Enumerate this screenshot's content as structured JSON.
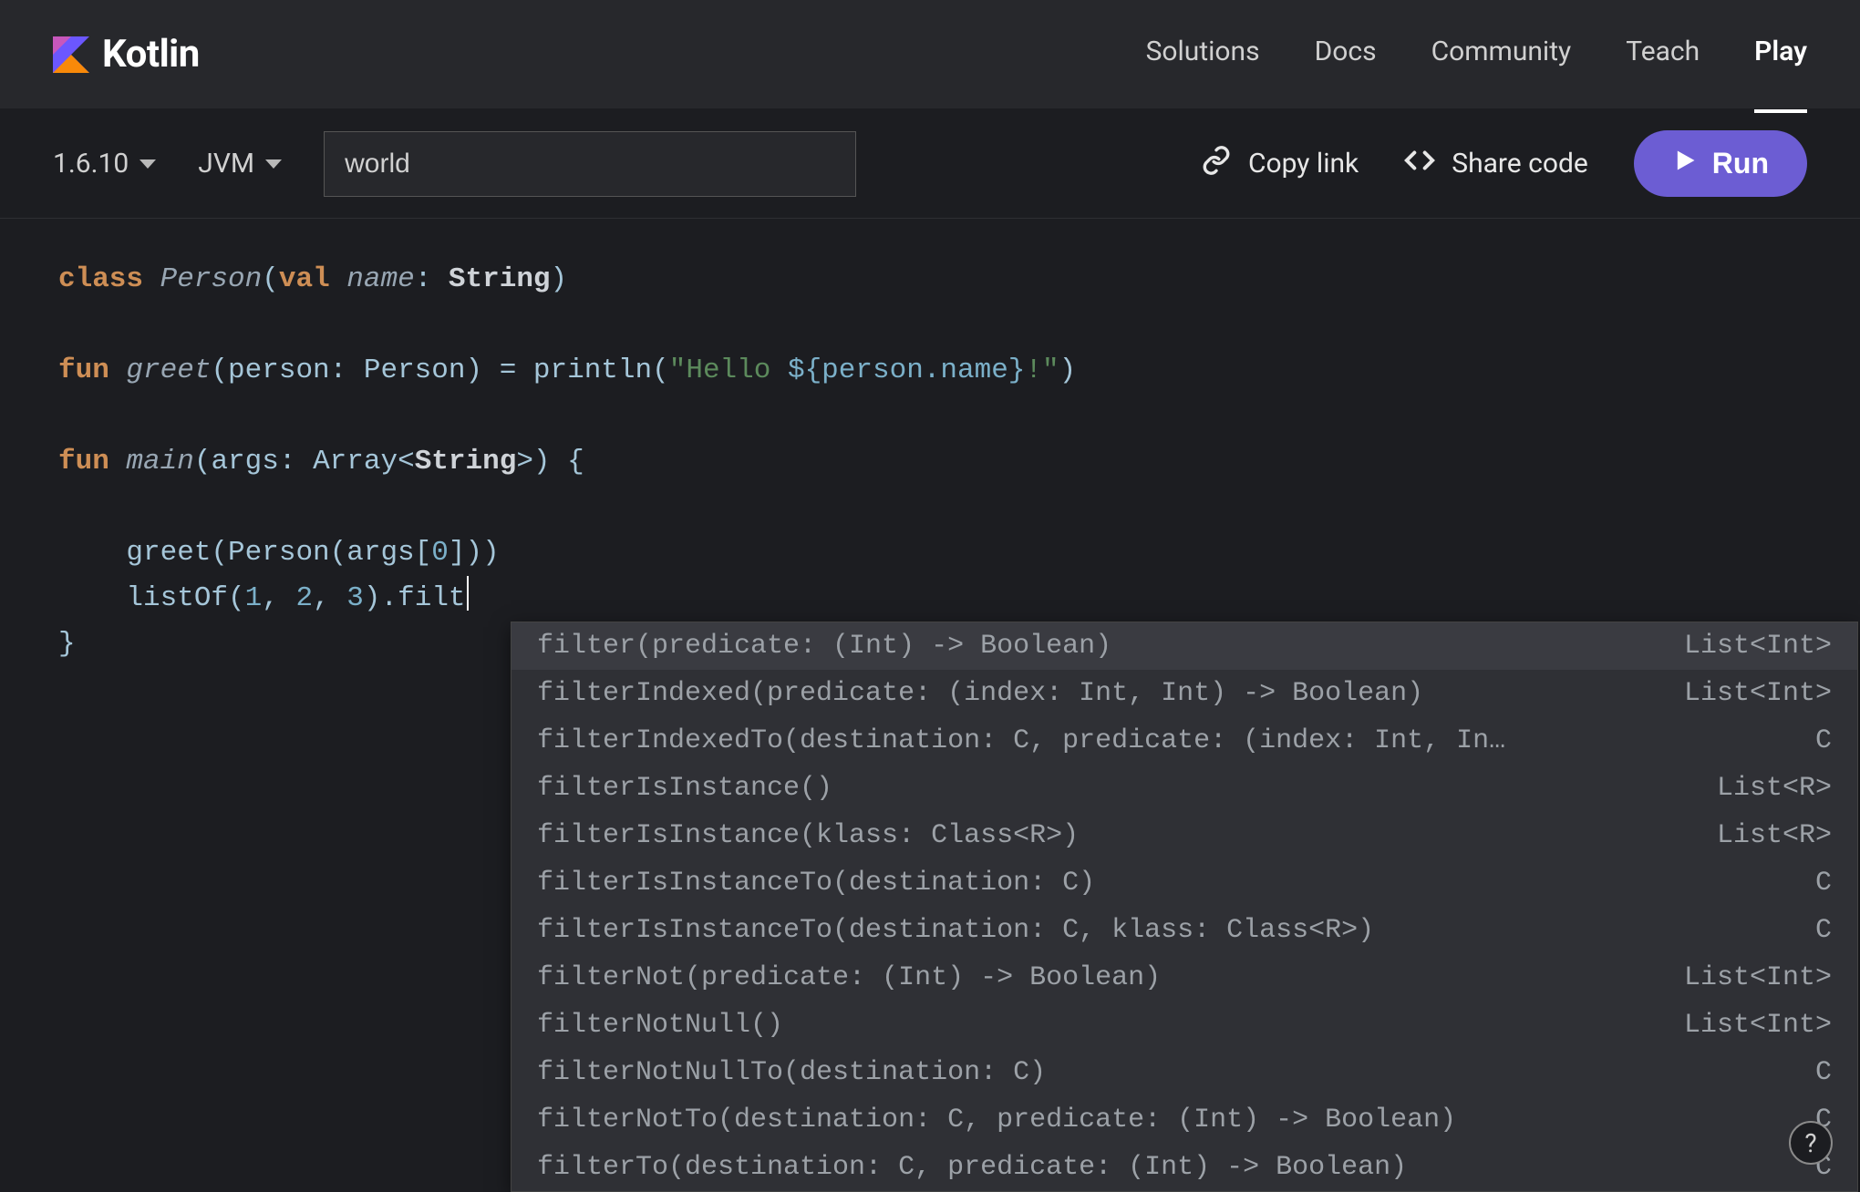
{
  "brand": {
    "name": "Kotlin"
  },
  "nav": {
    "items": [
      {
        "label": "Solutions",
        "active": false
      },
      {
        "label": "Docs",
        "active": false
      },
      {
        "label": "Community",
        "active": false
      },
      {
        "label": "Teach",
        "active": false
      },
      {
        "label": "Play",
        "active": true
      }
    ]
  },
  "toolbar": {
    "version": "1.6.10",
    "target": "JVM",
    "args_value": "world",
    "copy_link": "Copy link",
    "share_code": "Share code",
    "run": "Run"
  },
  "code": {
    "lines": [
      {
        "segments": [
          {
            "cls": "kw",
            "t": "class "
          },
          {
            "cls": "ident",
            "t": "Person"
          },
          {
            "cls": "plain",
            "t": "("
          },
          {
            "cls": "kw2",
            "t": "val "
          },
          {
            "cls": "ident",
            "t": "name"
          },
          {
            "cls": "plain",
            "t": ": "
          },
          {
            "cls": "type",
            "t": "String"
          },
          {
            "cls": "plain",
            "t": ")"
          }
        ]
      },
      {
        "segments": []
      },
      {
        "segments": [
          {
            "cls": "kw",
            "t": "fun "
          },
          {
            "cls": "ident",
            "t": "greet"
          },
          {
            "cls": "plain",
            "t": "(person: Person) = println("
          },
          {
            "cls": "str",
            "t": "\"Hello "
          },
          {
            "cls": "strvar",
            "t": "${person.name}"
          },
          {
            "cls": "str",
            "t": "!\""
          },
          {
            "cls": "plain",
            "t": ")"
          }
        ]
      },
      {
        "segments": []
      },
      {
        "segments": [
          {
            "cls": "kw",
            "t": "fun "
          },
          {
            "cls": "ident",
            "t": "main"
          },
          {
            "cls": "plain",
            "t": "(args: Array<"
          },
          {
            "cls": "type",
            "t": "String"
          },
          {
            "cls": "plain",
            "t": ">) {"
          }
        ]
      },
      {
        "segments": []
      },
      {
        "segments": [
          {
            "cls": "plain",
            "t": "    greet(Person(args["
          },
          {
            "cls": "num",
            "t": "0"
          },
          {
            "cls": "plain",
            "t": "]))"
          }
        ]
      },
      {
        "segments": [
          {
            "cls": "plain",
            "t": "    listOf("
          },
          {
            "cls": "num",
            "t": "1"
          },
          {
            "cls": "plain",
            "t": ", "
          },
          {
            "cls": "num",
            "t": "2"
          },
          {
            "cls": "plain",
            "t": ", "
          },
          {
            "cls": "num",
            "t": "3"
          },
          {
            "cls": "plain",
            "t": ").filt"
          }
        ],
        "cursor": true
      },
      {
        "segments": [
          {
            "cls": "plain",
            "t": "}"
          }
        ]
      }
    ]
  },
  "autocomplete": {
    "items": [
      {
        "sig": "filter(predicate: (Int) -> Boolean)",
        "ret": "List<Int>",
        "selected": true
      },
      {
        "sig": "filterIndexed(predicate: (index: Int, Int) -> Boolean)",
        "ret": "List<Int>",
        "selected": false
      },
      {
        "sig": "filterIndexedTo(destination: C, predicate: (index: Int, In…",
        "ret": "C",
        "selected": false
      },
      {
        "sig": "filterIsInstance()",
        "ret": "List<R>",
        "selected": false
      },
      {
        "sig": "filterIsInstance(klass: Class<R>)",
        "ret": "List<R>",
        "selected": false
      },
      {
        "sig": "filterIsInstanceTo(destination: C)",
        "ret": "C",
        "selected": false
      },
      {
        "sig": "filterIsInstanceTo(destination: C, klass: Class<R>)",
        "ret": "C",
        "selected": false
      },
      {
        "sig": "filterNot(predicate: (Int) -> Boolean)",
        "ret": "List<Int>",
        "selected": false
      },
      {
        "sig": "filterNotNull()",
        "ret": "List<Int>",
        "selected": false
      },
      {
        "sig": "filterNotNullTo(destination: C)",
        "ret": "C",
        "selected": false
      },
      {
        "sig": "filterNotTo(destination: C, predicate: (Int) -> Boolean)",
        "ret": "C",
        "selected": false
      },
      {
        "sig": "filterTo(destination: C, predicate: (Int) -> Boolean)",
        "ret": "C",
        "selected": false
      }
    ]
  },
  "help": {
    "label": "?"
  }
}
